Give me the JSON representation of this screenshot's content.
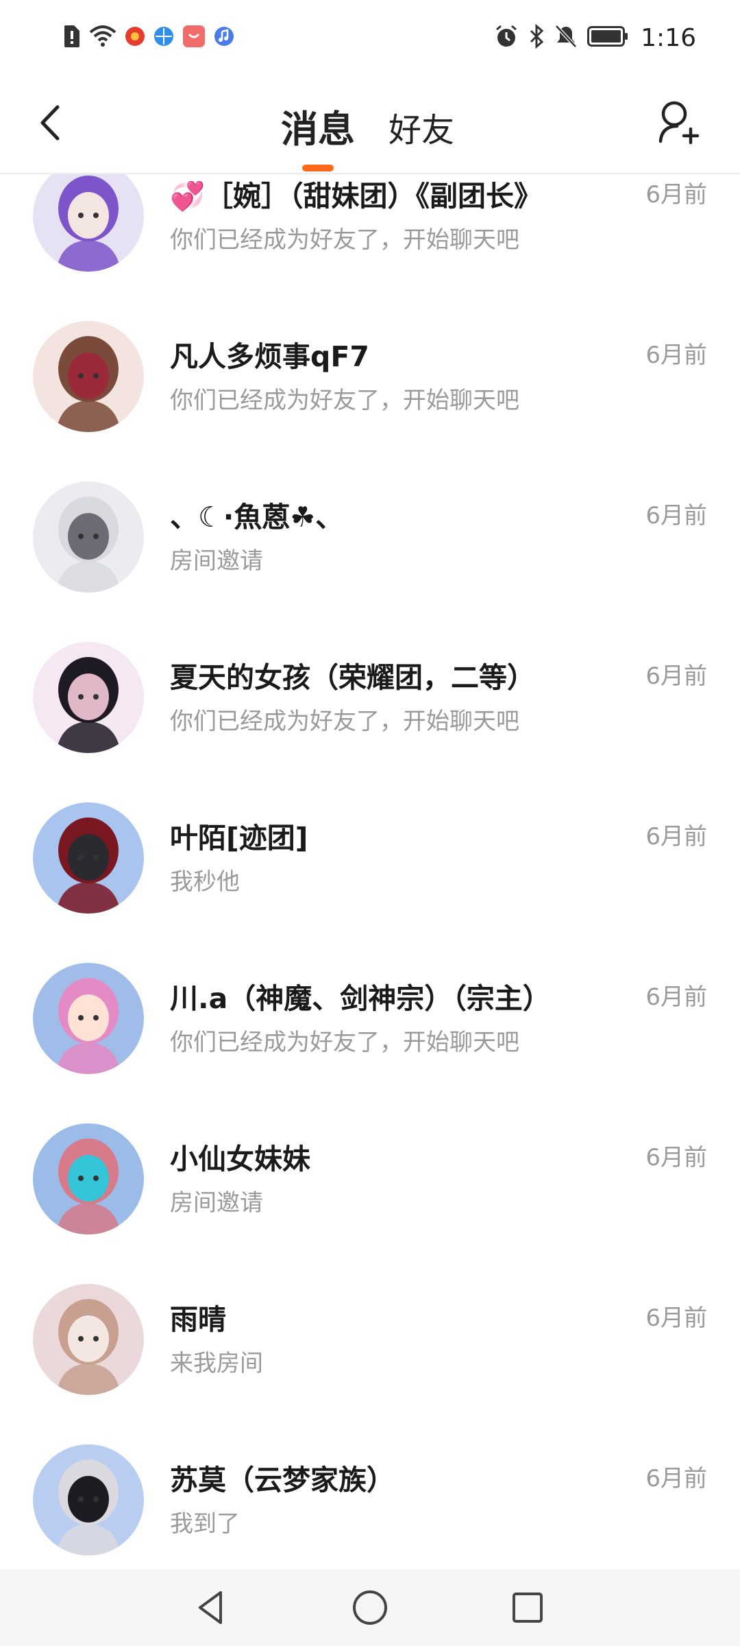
{
  "status_bar": {
    "time": "1:16",
    "left_icons": [
      "sim-alert-icon",
      "wifi-icon",
      "app-notification-icon",
      "browser-icon",
      "store-icon",
      "music-icon"
    ],
    "right_icons": [
      "alarm-icon",
      "bluetooth-icon",
      "mute-icon",
      "battery-icon"
    ]
  },
  "header": {
    "tab_messages": "消息",
    "tab_friends": "好友",
    "accent_color": "#ff6a1a"
  },
  "conversations": [
    {
      "name": "💞［婉］（甜妹团）《副团长》",
      "preview": "你们已经成为好友了，开始聊天吧",
      "time": "6月前",
      "avatar_colors": [
        "#e7e1f4",
        "#7b55c9",
        "#f3e6e0"
      ]
    },
    {
      "name": "凡人多烦事qF7",
      "preview": "你们已经成为好友了，开始聊天吧",
      "time": "6月前",
      "avatar_colors": [
        "#f4e4df",
        "#7a4a3a",
        "#9a2a3a"
      ]
    },
    {
      "name": "、☾·魚蒽☘、",
      "preview": "房间邀请",
      "time": "6月前",
      "avatar_colors": [
        "#ececf0",
        "#d9d9e0",
        "#6c6c74"
      ]
    },
    {
      "name": "夏天的女孩（荣耀团，二等）",
      "preview": "你们已经成为好友了，开始聊天吧",
      "time": "6月前",
      "avatar_colors": [
        "#f6e8f3",
        "#1d1a24",
        "#e0b8c8"
      ]
    },
    {
      "name": "叶陌[迹团]",
      "preview": "我秒他",
      "time": "6月前",
      "avatar_colors": [
        "#a9c4ee",
        "#7a1822",
        "#2a2a30"
      ]
    },
    {
      "name": "川.a（神魔、剑神宗）（宗主）",
      "preview": "你们已经成为好友了，开始聊天吧",
      "time": "6月前",
      "avatar_colors": [
        "#9fbde8",
        "#e48ac4",
        "#ffe2d6"
      ]
    },
    {
      "name": "小仙女妹妹",
      "preview": "房间邀请",
      "time": "6月前",
      "avatar_colors": [
        "#9bbbe9",
        "#d77a8a",
        "#34c6d8"
      ]
    },
    {
      "name": "雨晴",
      "preview": "来我房间",
      "time": "6月前",
      "avatar_colors": [
        "#ead8da",
        "#c7a090",
        "#f4e6e0"
      ]
    },
    {
      "name": "苏莫（云梦家族）",
      "preview": "我到了",
      "time": "6月前",
      "avatar_colors": [
        "#b9cdf0",
        "#d9d9df",
        "#1c1c22"
      ]
    }
  ],
  "nav_bar": {
    "icons": [
      "back-triangle-icon",
      "home-circle-icon",
      "recents-square-icon"
    ]
  }
}
